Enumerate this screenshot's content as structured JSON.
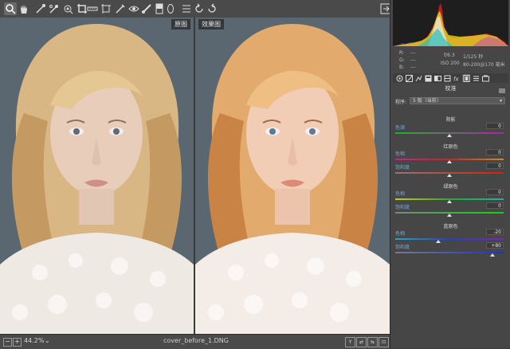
{
  "toolbar": {
    "tools": [
      {
        "name": "zoom-tool",
        "icon": "zoom-icon",
        "active": true
      },
      {
        "name": "hand-tool",
        "icon": "hand-icon",
        "active": false
      },
      {
        "name": "white-balance-tool",
        "icon": "eyedropper-icon",
        "active": false
      },
      {
        "name": "color-sampler-tool",
        "icon": "color-sampler-icon",
        "active": false
      },
      {
        "name": "targeted-adjustment-tool",
        "icon": "targeted-adjustment-icon",
        "active": false
      },
      {
        "name": "crop-tool",
        "icon": "crop-icon",
        "active": false
      },
      {
        "name": "straighten-tool",
        "icon": "straighten-icon",
        "active": false
      },
      {
        "name": "transform-tool",
        "icon": "transform-icon",
        "active": false
      },
      {
        "name": "spot-removal-tool",
        "icon": "spot-removal-icon",
        "active": false
      },
      {
        "name": "red-eye-tool",
        "icon": "red-eye-icon",
        "active": false
      },
      {
        "name": "adjustment-brush-tool",
        "icon": "brush-icon",
        "active": false
      },
      {
        "name": "graduated-filter-tool",
        "icon": "graduated-filter-icon",
        "active": false
      },
      {
        "name": "radial-filter-tool",
        "icon": "radial-filter-icon",
        "active": false
      },
      {
        "name": "preferences-tool",
        "icon": "list-icon",
        "active": false
      },
      {
        "name": "rotate-left-tool",
        "icon": "rotate-left-icon",
        "active": false
      },
      {
        "name": "rotate-right-tool",
        "icon": "rotate-right-icon",
        "active": false
      }
    ]
  },
  "viewer": {
    "before_label": "原图",
    "after_label": "效果图"
  },
  "status": {
    "zoom_out": "−",
    "zoom_in": "+",
    "zoom": "44.2%",
    "zoom_chevron": "⌄",
    "filename": "cover_before_1.DNG",
    "view_buttons": [
      "Y",
      "⇄",
      "⇆",
      "⊡"
    ]
  },
  "info": {
    "r_label": "R:",
    "g_label": "G:",
    "b_label": "B:",
    "r_value": "---",
    "g_value": "---",
    "b_value": "---",
    "aperture": "f/6.3",
    "shutter": "1/125 秒",
    "iso": "ISO 200",
    "lens": "80-200@170 毫米"
  },
  "panel": {
    "title": "校准",
    "process_label": "程序:",
    "process_value": "5 版（当前）",
    "sections": [
      {
        "title": "阴影",
        "sliders": [
          {
            "label": "色调",
            "value": "0",
            "pos": 0
          }
        ]
      },
      {
        "title": "红原色",
        "sliders": [
          {
            "label": "色相",
            "value": "0",
            "pos": 0
          },
          {
            "label": "饱和度",
            "value": "0",
            "pos": 0
          }
        ]
      },
      {
        "title": "绿原色",
        "sliders": [
          {
            "label": "色相",
            "value": "0",
            "pos": 0
          },
          {
            "label": "饱和度",
            "value": "0",
            "pos": 0
          }
        ]
      },
      {
        "title": "蓝原色",
        "sliders": [
          {
            "label": "色相",
            "value": "-20",
            "pos": -20
          },
          {
            "label": "饱和度",
            "value": "+80",
            "pos": 80
          }
        ]
      }
    ]
  },
  "colors": {
    "accent_label": "#6fa8dc",
    "panel_bg": "#464646",
    "toolbar_bg": "#4a4a4a",
    "photo_bg": "#5a6770"
  }
}
